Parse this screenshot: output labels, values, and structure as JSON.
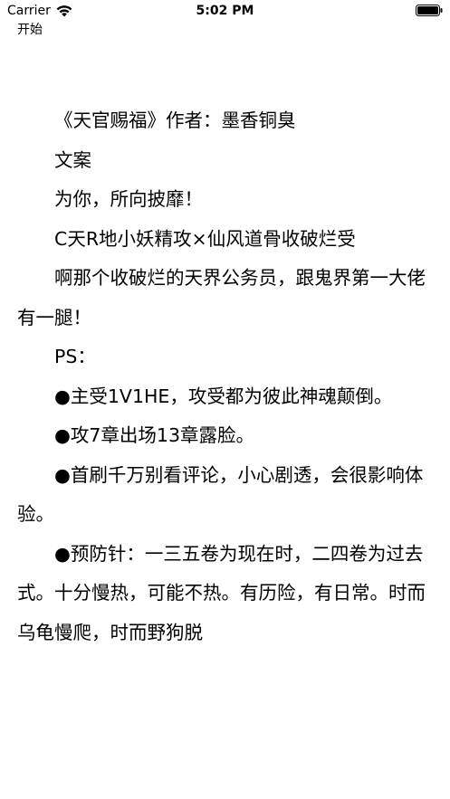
{
  "status_bar": {
    "carrier": "Carrier",
    "time": "5:02 PM",
    "icons": [
      "wifi-icon",
      "battery-icon"
    ]
  },
  "nav": {
    "start_label": "开始"
  },
  "reader": {
    "paragraphs": [
      "《天官赐福》作者：墨香铜臭",
      "文案",
      "为你，所向披靡！",
      "C天R地小妖精攻×仙风道骨收破烂受",
      "啊那个收破烂的天界公务员，跟鬼界第一大佬有一腿！",
      "PS：",
      "●主受1V1HE，攻受都为彼此神魂颠倒。",
      "●攻7章出场13章露脸。",
      "●首刷千万别看评论，小心剧透，会很影响体验。",
      "●预防针：一三五卷为现在时，二四卷为过去式。十分慢热，可能不热。有历险，有日常。时而乌龟慢爬，时而野狗脱"
    ]
  }
}
